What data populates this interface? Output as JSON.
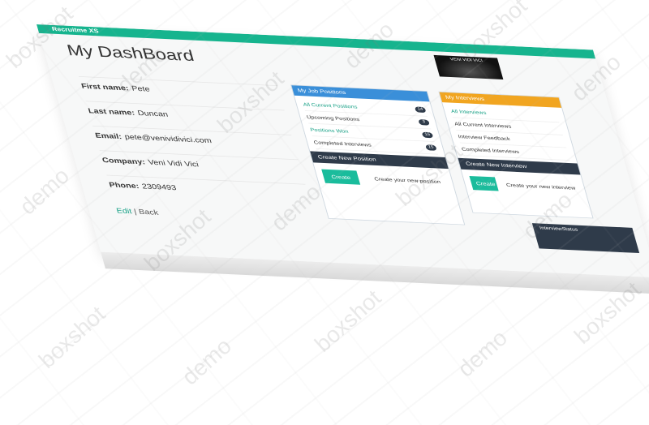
{
  "app": {
    "brand": "Recruitme XS",
    "menu": [
      "",
      "",
      ""
    ]
  },
  "logo_text": "VENI VIDI VICI",
  "page": {
    "title": "My DashBoard"
  },
  "profile": [
    {
      "label": "First name:",
      "value": "Pete"
    },
    {
      "label": "Last name:",
      "value": "Duncan"
    },
    {
      "label": "Email:",
      "value": "pete@venividivici.com"
    },
    {
      "label": "Company:",
      "value": "Veni Vidi Vici"
    },
    {
      "label": "Phone:",
      "value": "2309493"
    }
  ],
  "actions": {
    "edit": "Edit",
    "separator": "|",
    "back": "Back"
  },
  "jobs": {
    "title": "My Job Positions",
    "items": [
      {
        "label": "All Current Positions",
        "count": "14"
      },
      {
        "label": "Upcoming Positions",
        "count": "3"
      },
      {
        "label": "Positions Won",
        "count": "15"
      },
      {
        "label": "Completed Interviews",
        "count": "15"
      }
    ],
    "create_title": "Create New Position",
    "create_button": "Create",
    "create_text": "Create your new position"
  },
  "interviews": {
    "title": "My Interviews",
    "items": [
      {
        "label": "All Interviews",
        "count": ""
      },
      {
        "label": "All Current Interviews",
        "count": ""
      },
      {
        "label": "Interview Feedback",
        "count": ""
      },
      {
        "label": "Completed Interviews",
        "count": ""
      }
    ],
    "create_title": "Create New Interview",
    "create_button": "Create",
    "create_text": "Create your new interview"
  },
  "third_panel": {
    "title": "InterviewStatus"
  },
  "watermark": {
    "words": [
      "boxshot",
      "demo"
    ]
  },
  "colors": {
    "accent": "#16b48e",
    "blue": "#3a8fd9",
    "orange": "#f1a520",
    "dark": "#2f3b4a"
  }
}
